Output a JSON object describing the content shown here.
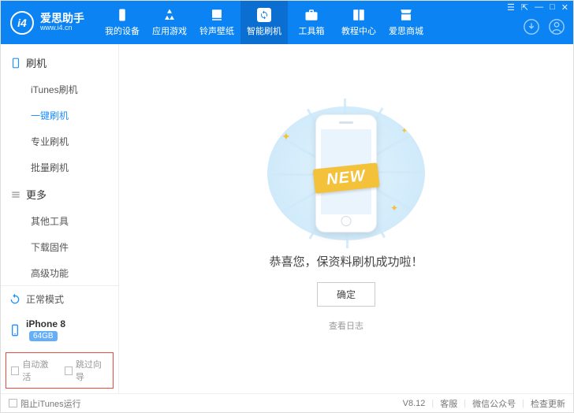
{
  "logo": {
    "badge": "i4",
    "title": "爱思助手",
    "subtitle": "www.i4.cn"
  },
  "nav": [
    {
      "label": "我的设备"
    },
    {
      "label": "应用游戏"
    },
    {
      "label": "铃声壁纸"
    },
    {
      "label": "智能刷机"
    },
    {
      "label": "工具箱"
    },
    {
      "label": "教程中心"
    },
    {
      "label": "爱思商城"
    }
  ],
  "sidebar": {
    "group1": {
      "title": "刷机",
      "items": [
        "iTunes刷机",
        "一键刷机",
        "专业刷机",
        "批量刷机"
      ]
    },
    "group2": {
      "title": "更多",
      "items": [
        "其他工具",
        "下载固件",
        "高级功能"
      ]
    },
    "mode": "正常模式",
    "device": {
      "name": "iPhone 8",
      "storage": "64GB"
    },
    "opts": {
      "auto_activate": "自动激活",
      "skip_guide": "跳过向导"
    }
  },
  "main": {
    "ribbon": "NEW",
    "message": "恭喜您，保资料刷机成功啦！",
    "confirm": "确定",
    "view_log": "查看日志"
  },
  "footer": {
    "block_itunes": "阻止iTunes运行",
    "version": "V8.12",
    "support": "客服",
    "wechat": "微信公众号",
    "update": "检查更新"
  }
}
